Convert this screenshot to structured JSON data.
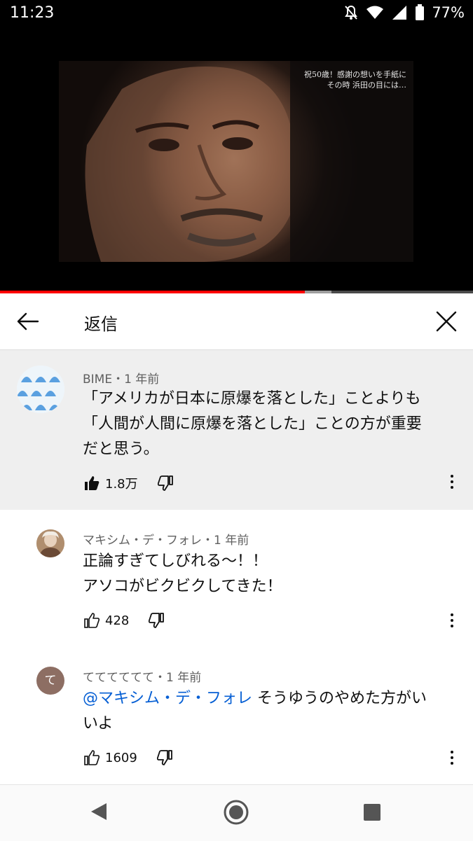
{
  "status_bar": {
    "time": "11:23",
    "battery": "77%"
  },
  "video": {
    "caption_line1": "祝50歳！感謝の想いを手紙に",
    "caption_line2": "その時 浜田の目には…",
    "progress_played": 0.645,
    "progress_buffered": 0.7
  },
  "header": {
    "title": "返信"
  },
  "parent_comment": {
    "author_meta": "BIME・1 年前",
    "text_line1": "「アメリカが日本に原爆を落とした」ことよりも",
    "text_line2": "「人間が人間に原爆を落とした」ことの方が重要",
    "text_line3": "だと思う。",
    "likes": "1.8万"
  },
  "replies": [
    {
      "author_meta": "マキシム・デ・フォレ・1 年前",
      "text_line1": "正論すぎてしびれる〜！！",
      "text_line2": "アソコがビクビクしてきた！",
      "likes": "428"
    },
    {
      "avatar_letter": "て",
      "author_meta": "てててててて・1 年前",
      "mention": "@マキシム・デ・フォレ",
      "text_after_mention": "そうゆうのやめた方がい",
      "text_line2": "いよ",
      "likes": "1609"
    }
  ],
  "colors": {
    "accent_red": "#ff0000",
    "mention_blue": "#065fd4",
    "avatar_brown": "#8d6e63"
  },
  "icons": [
    "back-arrow-icon",
    "close-icon",
    "thumb-up-icon",
    "thumb-down-icon",
    "more-vert-icon",
    "nav-back-icon",
    "nav-home-icon",
    "nav-recents-icon"
  ]
}
